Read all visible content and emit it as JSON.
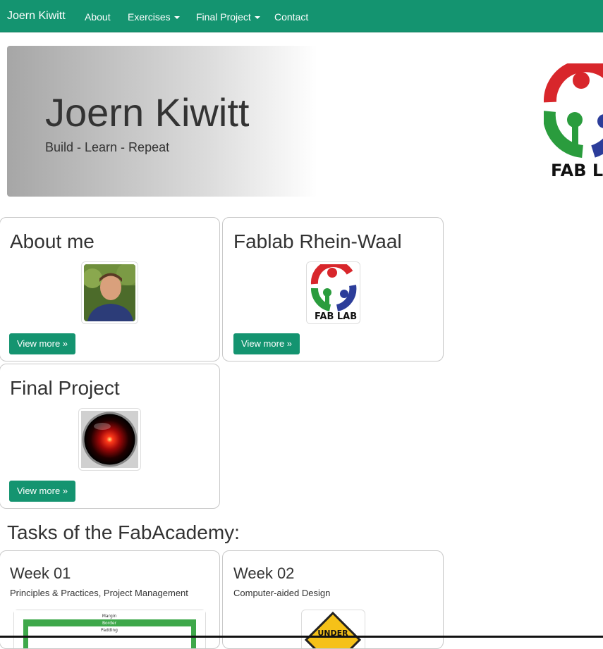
{
  "navbar": {
    "brand": "Joern Kiwitt",
    "items": [
      {
        "label": "About",
        "dropdown": false
      },
      {
        "label": "Exercises",
        "dropdown": true
      },
      {
        "label": "Final Project",
        "dropdown": true
      },
      {
        "label": "Contact",
        "dropdown": false
      }
    ]
  },
  "jumbotron": {
    "title": "Joern Kiwitt",
    "tagline": "Build - Learn - Repeat",
    "logo_text": "FAB LAB"
  },
  "cards": [
    {
      "title": "About me",
      "button": "View more »",
      "image": "profile-photo"
    },
    {
      "title": "Fablab Rhein-Waal",
      "button": "View more »",
      "image": "fablab-logo",
      "logo_text": "FAB LAB"
    },
    {
      "title": "Final Project",
      "button": "View more »",
      "image": "hal-9000-eye"
    }
  ],
  "tasks": {
    "heading": "Tasks of the FabAcademy:",
    "weeks": [
      {
        "title": "Week 01",
        "description": "Principles & Practices, Project Management",
        "box_model_labels": [
          "Margin",
          "Border",
          "Padding"
        ]
      },
      {
        "title": "Week 02",
        "description": "Computer-aided Design",
        "sign_text": "UNDER"
      }
    ]
  },
  "colors": {
    "brand": "#149470",
    "logo_red": "#d8262b",
    "logo_green": "#2a9c3d",
    "logo_blue": "#2c3d9a"
  }
}
